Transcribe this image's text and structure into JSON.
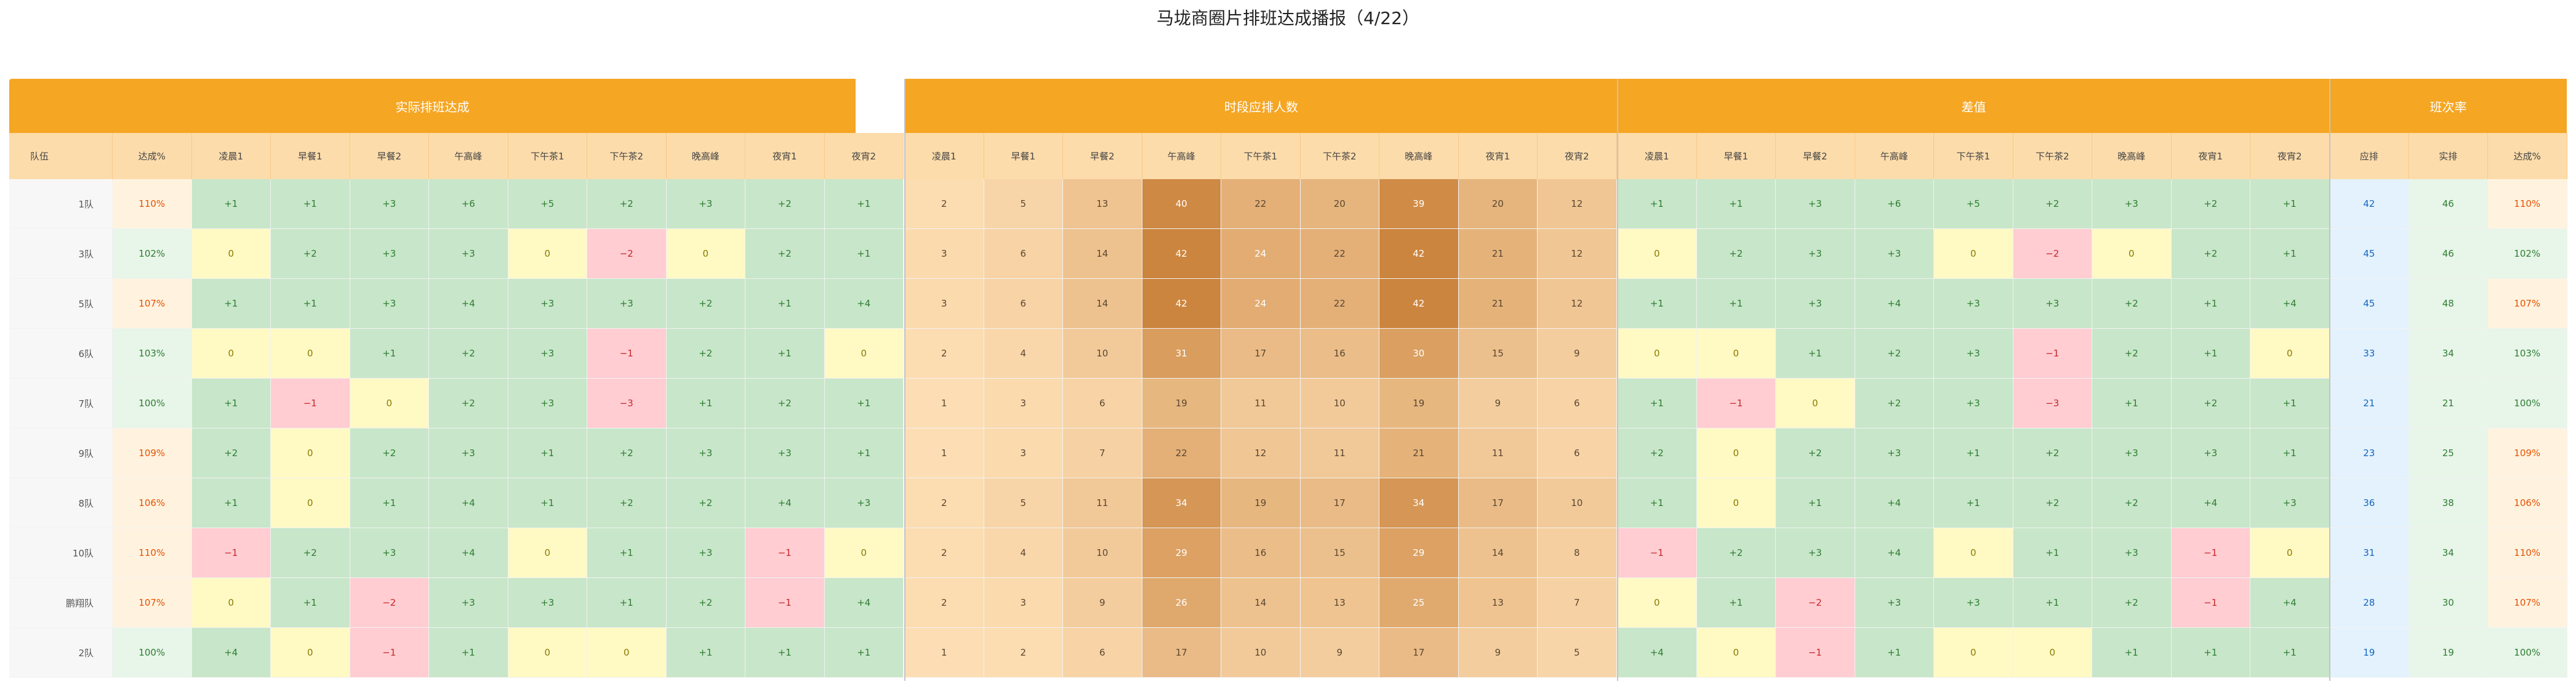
{
  "title": "马垅商圈片排班达成播报（4/22）",
  "groups": {
    "actual": "实际排班达成",
    "required": "时段应排人数",
    "diff": "差值",
    "rate": "班次率"
  },
  "headers": {
    "team": "队伍",
    "achieve": "达成%",
    "slots": [
      "凌晨1",
      "早餐1",
      "早餐2",
      "午高峰",
      "下午茶1",
      "下午茶2",
      "晚高峰",
      "夜宵1",
      "夜宵2"
    ],
    "rate_cols": [
      "应排",
      "实排",
      "达成%"
    ]
  },
  "colors": {
    "header_bar": "#f5a623",
    "header_cell": "#fddcab",
    "positive": "#c8e6c9",
    "zero": "#fff9c4",
    "negative": "#ffcdd2",
    "pct_high": "#fff3e0",
    "rate_blue": "#e3f2fd",
    "rate_green": "#e8f5e9"
  },
  "rows": [
    {
      "team": "1队",
      "pct": "110%",
      "actual": [
        "+1",
        "+1",
        "+3",
        "+6",
        "+5",
        "+2",
        "+3",
        "+2",
        "+1"
      ],
      "required": [
        2,
        5,
        13,
        40,
        22,
        20,
        39,
        20,
        12
      ],
      "diff": [
        "+1",
        "+1",
        "+3",
        "+6",
        "+5",
        "+2",
        "+3",
        "+2",
        "+1"
      ],
      "plan": 42,
      "real": 46,
      "rate": "110%"
    },
    {
      "team": "3队",
      "pct": "102%",
      "actual": [
        "0",
        "+2",
        "+3",
        "+3",
        "0",
        "−2",
        "0",
        "+2",
        "+1"
      ],
      "required": [
        3,
        6,
        14,
        42,
        24,
        22,
        42,
        21,
        12
      ],
      "diff": [
        "0",
        "+2",
        "+3",
        "+3",
        "0",
        "−2",
        "0",
        "+2",
        "+1"
      ],
      "plan": 45,
      "real": 46,
      "rate": "102%"
    },
    {
      "team": "5队",
      "pct": "107%",
      "actual": [
        "+1",
        "+1",
        "+3",
        "+4",
        "+3",
        "+3",
        "+2",
        "+1",
        "+4"
      ],
      "required": [
        3,
        6,
        14,
        42,
        24,
        22,
        42,
        21,
        12
      ],
      "diff": [
        "+1",
        "+1",
        "+3",
        "+4",
        "+3",
        "+3",
        "+2",
        "+1",
        "+4"
      ],
      "plan": 45,
      "real": 48,
      "rate": "107%"
    },
    {
      "team": "6队",
      "pct": "103%",
      "actual": [
        "0",
        "0",
        "+1",
        "+2",
        "+3",
        "−1",
        "+2",
        "+1",
        "0"
      ],
      "required": [
        2,
        4,
        10,
        31,
        17,
        16,
        30,
        15,
        9
      ],
      "diff": [
        "0",
        "0",
        "+1",
        "+2",
        "+3",
        "−1",
        "+2",
        "+1",
        "0"
      ],
      "plan": 33,
      "real": 34,
      "rate": "103%"
    },
    {
      "team": "7队",
      "pct": "100%",
      "actual": [
        "+1",
        "−1",
        "0",
        "+2",
        "+3",
        "−3",
        "+1",
        "+2",
        "+1"
      ],
      "required": [
        1,
        3,
        6,
        19,
        11,
        10,
        19,
        9,
        6
      ],
      "diff": [
        "+1",
        "−1",
        "0",
        "+2",
        "+3",
        "−3",
        "+1",
        "+2",
        "+1"
      ],
      "plan": 21,
      "real": 21,
      "rate": "100%"
    },
    {
      "team": "9队",
      "pct": "109%",
      "actual": [
        "+2",
        "0",
        "+2",
        "+3",
        "+1",
        "+2",
        "+3",
        "+3",
        "+1"
      ],
      "required": [
        1,
        3,
        7,
        22,
        12,
        11,
        21,
        11,
        6
      ],
      "diff": [
        "+2",
        "0",
        "+2",
        "+3",
        "+1",
        "+2",
        "+3",
        "+3",
        "+1"
      ],
      "plan": 23,
      "real": 25,
      "rate": "109%"
    },
    {
      "team": "8队",
      "pct": "106%",
      "actual": [
        "+1",
        "0",
        "+1",
        "+4",
        "+1",
        "+2",
        "+2",
        "+4",
        "+3"
      ],
      "required": [
        2,
        5,
        11,
        34,
        19,
        17,
        34,
        17,
        10
      ],
      "diff": [
        "+1",
        "0",
        "+1",
        "+4",
        "+1",
        "+2",
        "+2",
        "+4",
        "+3"
      ],
      "plan": 36,
      "real": 38,
      "rate": "106%"
    },
    {
      "team": "10队",
      "pct": "110%",
      "actual": [
        "−1",
        "+2",
        "+3",
        "+4",
        "0",
        "+1",
        "+3",
        "−1",
        "0"
      ],
      "required": [
        2,
        4,
        10,
        29,
        16,
        15,
        29,
        14,
        8
      ],
      "diff": [
        "−1",
        "+2",
        "+3",
        "+4",
        "0",
        "+1",
        "+3",
        "−1",
        "0"
      ],
      "plan": 31,
      "real": 34,
      "rate": "110%"
    },
    {
      "team": "鹏翔队",
      "pct": "107%",
      "actual": [
        "0",
        "+1",
        "−2",
        "+3",
        "+3",
        "+1",
        "+2",
        "−1",
        "+4"
      ],
      "required": [
        2,
        3,
        9,
        26,
        14,
        13,
        25,
        13,
        7
      ],
      "diff": [
        "0",
        "+1",
        "−2",
        "+3",
        "+3",
        "+1",
        "+2",
        "−1",
        "+4"
      ],
      "plan": 28,
      "real": 30,
      "rate": "107%"
    },
    {
      "team": "2队",
      "pct": "100%",
      "actual": [
        "+4",
        "0",
        "−1",
        "+1",
        "0",
        "0",
        "+1",
        "+1",
        "+1"
      ],
      "required": [
        1,
        2,
        6,
        17,
        10,
        9,
        17,
        9,
        5
      ],
      "diff": [
        "+4",
        "0",
        "−1",
        "+1",
        "0",
        "0",
        "+1",
        "+1",
        "+1"
      ],
      "plan": 19,
      "real": 19,
      "rate": "100%"
    }
  ]
}
